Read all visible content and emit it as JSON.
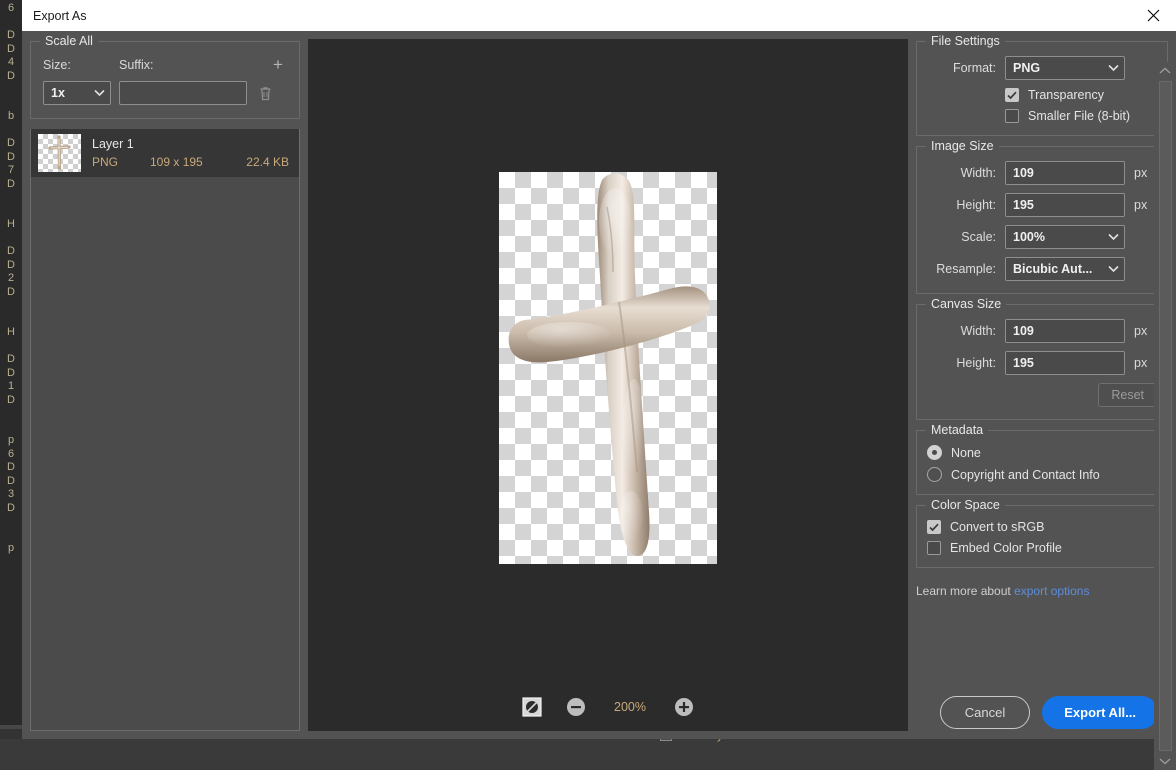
{
  "window": {
    "title": "Export As",
    "close_icon": "close-icon"
  },
  "scale_all": {
    "legend": "Scale All",
    "size_label": "Size:",
    "suffix_label": "Suffix:",
    "size_value": "1x",
    "suffix_value": "",
    "suffix_placeholder": "",
    "add_icon": "plus-icon",
    "delete_icon": "trash-icon"
  },
  "layers": [
    {
      "name": "Layer 1",
      "format": "PNG",
      "dimensions": "109 x 195",
      "filesize": "22.4 KB"
    }
  ],
  "preview": {
    "zoom_level": "200%",
    "toggle_transparency_icon": "transparency-toggle-icon",
    "zoom_out_icon": "minus-circle-icon",
    "zoom_in_icon": "plus-circle-icon"
  },
  "file_settings": {
    "legend": "File Settings",
    "format_label": "Format:",
    "format_value": "PNG",
    "transparency_label": "Transparency",
    "transparency_checked": true,
    "smaller_file_label": "Smaller File (8-bit)",
    "smaller_file_checked": false
  },
  "image_size": {
    "legend": "Image Size",
    "width_label": "Width:",
    "width_value": "109",
    "width_unit": "px",
    "height_label": "Height:",
    "height_value": "195",
    "height_unit": "px",
    "scale_label": "Scale:",
    "scale_value": "100%",
    "resample_label": "Resample:",
    "resample_value": "Bicubic Aut..."
  },
  "canvas_size": {
    "legend": "Canvas Size",
    "width_label": "Width:",
    "width_value": "109",
    "width_unit": "px",
    "height_label": "Height:",
    "height_value": "195",
    "height_unit": "px",
    "reset_label": "Reset"
  },
  "metadata": {
    "legend": "Metadata",
    "none_label": "None",
    "none_selected": true,
    "copyright_label": "Copyright and Contact Info",
    "copyright_selected": false
  },
  "color_space": {
    "legend": "Color Space",
    "convert_srgb_label": "Convert to sRGB",
    "convert_srgb_checked": true,
    "embed_profile_label": "Embed Color Profile",
    "embed_profile_checked": false
  },
  "help": {
    "text": "Learn more about ",
    "link": "export options"
  },
  "footer": {
    "cancel_label": "Cancel",
    "export_label": "Export All..."
  },
  "background": {
    "edge_chars": [
      "6",
      "",
      "D",
      "D",
      "4",
      "D",
      "",
      "",
      "b",
      "",
      "D",
      "D",
      "7",
      "D",
      "",
      "",
      "H",
      "",
      "D",
      "D",
      "2",
      "D",
      "",
      "",
      "H",
      "",
      "D",
      "D",
      "1",
      "D",
      "",
      "",
      "p",
      "6",
      "D",
      "D",
      "3",
      "D",
      "",
      "",
      "p"
    ],
    "birthday_label": "Birthday"
  },
  "colors": {
    "accent": "#1473e6",
    "dialog_bg": "#535353",
    "preview_bg": "#2b2b2b",
    "link": "#5b8fdd",
    "meta_text": "#c9a979"
  }
}
